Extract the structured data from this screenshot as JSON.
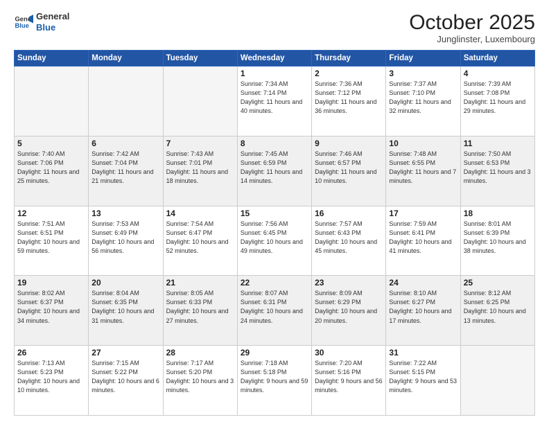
{
  "header": {
    "logo_line1": "General",
    "logo_line2": "Blue",
    "month": "October 2025",
    "location": "Junglinster, Luxembourg"
  },
  "weekdays": [
    "Sunday",
    "Monday",
    "Tuesday",
    "Wednesday",
    "Thursday",
    "Friday",
    "Saturday"
  ],
  "weeks": [
    [
      {
        "day": "",
        "info": ""
      },
      {
        "day": "",
        "info": ""
      },
      {
        "day": "",
        "info": ""
      },
      {
        "day": "1",
        "info": "Sunrise: 7:34 AM\nSunset: 7:14 PM\nDaylight: 11 hours\nand 40 minutes."
      },
      {
        "day": "2",
        "info": "Sunrise: 7:36 AM\nSunset: 7:12 PM\nDaylight: 11 hours\nand 36 minutes."
      },
      {
        "day": "3",
        "info": "Sunrise: 7:37 AM\nSunset: 7:10 PM\nDaylight: 11 hours\nand 32 minutes."
      },
      {
        "day": "4",
        "info": "Sunrise: 7:39 AM\nSunset: 7:08 PM\nDaylight: 11 hours\nand 29 minutes."
      }
    ],
    [
      {
        "day": "5",
        "info": "Sunrise: 7:40 AM\nSunset: 7:06 PM\nDaylight: 11 hours\nand 25 minutes."
      },
      {
        "day": "6",
        "info": "Sunrise: 7:42 AM\nSunset: 7:04 PM\nDaylight: 11 hours\nand 21 minutes."
      },
      {
        "day": "7",
        "info": "Sunrise: 7:43 AM\nSunset: 7:01 PM\nDaylight: 11 hours\nand 18 minutes."
      },
      {
        "day": "8",
        "info": "Sunrise: 7:45 AM\nSunset: 6:59 PM\nDaylight: 11 hours\nand 14 minutes."
      },
      {
        "day": "9",
        "info": "Sunrise: 7:46 AM\nSunset: 6:57 PM\nDaylight: 11 hours\nand 10 minutes."
      },
      {
        "day": "10",
        "info": "Sunrise: 7:48 AM\nSunset: 6:55 PM\nDaylight: 11 hours\nand 7 minutes."
      },
      {
        "day": "11",
        "info": "Sunrise: 7:50 AM\nSunset: 6:53 PM\nDaylight: 11 hours\nand 3 minutes."
      }
    ],
    [
      {
        "day": "12",
        "info": "Sunrise: 7:51 AM\nSunset: 6:51 PM\nDaylight: 10 hours\nand 59 minutes."
      },
      {
        "day": "13",
        "info": "Sunrise: 7:53 AM\nSunset: 6:49 PM\nDaylight: 10 hours\nand 56 minutes."
      },
      {
        "day": "14",
        "info": "Sunrise: 7:54 AM\nSunset: 6:47 PM\nDaylight: 10 hours\nand 52 minutes."
      },
      {
        "day": "15",
        "info": "Sunrise: 7:56 AM\nSunset: 6:45 PM\nDaylight: 10 hours\nand 49 minutes."
      },
      {
        "day": "16",
        "info": "Sunrise: 7:57 AM\nSunset: 6:43 PM\nDaylight: 10 hours\nand 45 minutes."
      },
      {
        "day": "17",
        "info": "Sunrise: 7:59 AM\nSunset: 6:41 PM\nDaylight: 10 hours\nand 41 minutes."
      },
      {
        "day": "18",
        "info": "Sunrise: 8:01 AM\nSunset: 6:39 PM\nDaylight: 10 hours\nand 38 minutes."
      }
    ],
    [
      {
        "day": "19",
        "info": "Sunrise: 8:02 AM\nSunset: 6:37 PM\nDaylight: 10 hours\nand 34 minutes."
      },
      {
        "day": "20",
        "info": "Sunrise: 8:04 AM\nSunset: 6:35 PM\nDaylight: 10 hours\nand 31 minutes."
      },
      {
        "day": "21",
        "info": "Sunrise: 8:05 AM\nSunset: 6:33 PM\nDaylight: 10 hours\nand 27 minutes."
      },
      {
        "day": "22",
        "info": "Sunrise: 8:07 AM\nSunset: 6:31 PM\nDaylight: 10 hours\nand 24 minutes."
      },
      {
        "day": "23",
        "info": "Sunrise: 8:09 AM\nSunset: 6:29 PM\nDaylight: 10 hours\nand 20 minutes."
      },
      {
        "day": "24",
        "info": "Sunrise: 8:10 AM\nSunset: 6:27 PM\nDaylight: 10 hours\nand 17 minutes."
      },
      {
        "day": "25",
        "info": "Sunrise: 8:12 AM\nSunset: 6:25 PM\nDaylight: 10 hours\nand 13 minutes."
      }
    ],
    [
      {
        "day": "26",
        "info": "Sunrise: 7:13 AM\nSunset: 5:23 PM\nDaylight: 10 hours\nand 10 minutes."
      },
      {
        "day": "27",
        "info": "Sunrise: 7:15 AM\nSunset: 5:22 PM\nDaylight: 10 hours\nand 6 minutes."
      },
      {
        "day": "28",
        "info": "Sunrise: 7:17 AM\nSunset: 5:20 PM\nDaylight: 10 hours\nand 3 minutes."
      },
      {
        "day": "29",
        "info": "Sunrise: 7:18 AM\nSunset: 5:18 PM\nDaylight: 9 hours\nand 59 minutes."
      },
      {
        "day": "30",
        "info": "Sunrise: 7:20 AM\nSunset: 5:16 PM\nDaylight: 9 hours\nand 56 minutes."
      },
      {
        "day": "31",
        "info": "Sunrise: 7:22 AM\nSunset: 5:15 PM\nDaylight: 9 hours\nand 53 minutes."
      },
      {
        "day": "",
        "info": ""
      }
    ]
  ]
}
